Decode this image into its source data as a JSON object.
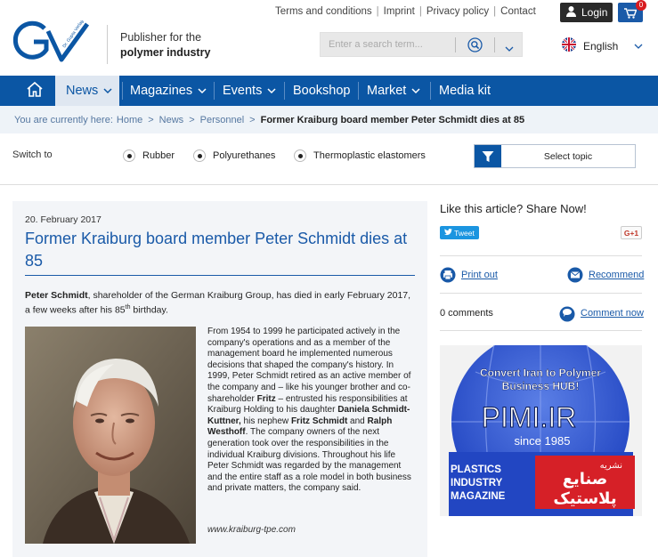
{
  "top_links": [
    "Terms and conditions",
    "Imprint",
    "Privacy policy",
    "Contact"
  ],
  "login_label": "Login",
  "cart_count": "0",
  "tagline": {
    "line1": "Publisher for the",
    "line2": "polymer industry"
  },
  "logo_small_text": "Dr. Gupta Verlag",
  "search": {
    "placeholder": "Enter a search term..."
  },
  "language": "English",
  "nav": {
    "items": [
      {
        "label": "News"
      },
      {
        "label": "Magazines"
      },
      {
        "label": "Events"
      },
      {
        "label": "Bookshop"
      },
      {
        "label": "Market"
      },
      {
        "label": "Media kit"
      }
    ]
  },
  "breadcrumb": {
    "prefix": "You are currently here:",
    "items": [
      "Home",
      "News",
      "Personnel"
    ],
    "current": "Former Kraiburg board member Peter Schmidt dies at 85"
  },
  "switch": {
    "label": "Switch to",
    "options": [
      "Rubber",
      "Polyurethanes",
      "Thermoplastic elastomers"
    ],
    "select_topic": "Select topic"
  },
  "article": {
    "date": "20. February 2017",
    "title": "Former Kraiburg board member Peter Schmidt dies at 85",
    "lead_name": "Peter Schmidt",
    "lead_text_1": ", shareholder of the German Kraiburg Group, has died in early February 2017, a few weeks after his 85",
    "lead_sup": "th",
    "lead_text_2": " birthday.",
    "body_1": "From 1954 to 1999 he participated actively in the company's operations and as a member of the management board he implemented numerous decisions that shaped the company's history. In 1999, Peter Schmidt retired as an active member of the company and – like his younger brother and co-shareholder ",
    "body_fritz": "Fritz",
    "body_2": " – entrusted his responsibilities at Kraiburg Holding to his daughter ",
    "body_daniela": "Daniela Schmidt-Kuttner,",
    "body_3": " his nephew ",
    "body_fritz_schmidt": "Fritz Schmidt",
    "body_4": " and ",
    "body_ralph": "Ralph Westhoff",
    "body_5": ". The company owners of the next generation took over the responsibilities in the individual Kraiburg divisions. Throughout his life Peter Schmidt was regarded by the management and the entire staff as a role model in both business and private matters, the company said.",
    "source": "www.kraiburg-tpe.com"
  },
  "sidebar": {
    "share_title": "Like this article? Share Now!",
    "tweet_label": "Tweet",
    "gplus_label": "G+1",
    "print_label": "Print out",
    "recommend_label": "Recommend",
    "comments_count": "0 comments",
    "comment_now": "Comment now"
  },
  "ad": {
    "line1": "Convert Iran to Polymer",
    "line2": "Business HUB!",
    "brand": "PIMI.IR",
    "since": "since 1985",
    "mag1": "PLASTICS",
    "mag2": "INDUSTRY",
    "mag3": "MAGAZINE",
    "persian1": "نشریه",
    "persian2": "صنایع",
    "persian3": "پلاستیک"
  },
  "colors": {
    "brand_blue": "#0b56a4",
    "link_blue": "#1a5aa8",
    "badge_red": "#d81b20"
  }
}
